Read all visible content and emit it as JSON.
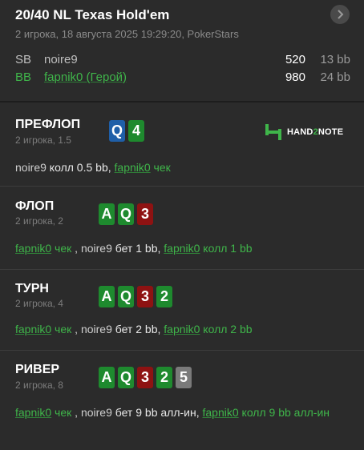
{
  "header": {
    "title": "20/40 NL Texas Hold'em",
    "subtitle": "2 игрока, 18 августа 2025 19:29:20, PokerStars"
  },
  "players": [
    {
      "pos": "SB",
      "name": "noire9",
      "stack": "520",
      "bb": "13 bb"
    },
    {
      "pos": "BB",
      "name": "fapnik0 (Герой)",
      "stack": "980",
      "bb": "24 bb"
    }
  ],
  "logo": {
    "text_a": "HAND",
    "text_b": "2",
    "text_c": "NOTE"
  },
  "colors": {
    "green": "#3fb54a",
    "card_green": "#1e8a2e",
    "card_red": "#8e1212",
    "card_blue": "#1f5fa8",
    "card_gray": "#7a7a7a"
  },
  "streets": [
    {
      "name": "ПРЕФЛОП",
      "sub": "2 игрока, 1.5",
      "cards": [
        {
          "rank": "Q",
          "suit": "blue"
        },
        {
          "rank": "4",
          "suit": "green"
        }
      ],
      "actions": [
        {
          "who": "noire9",
          "hero": false,
          "act": " колл 0.5 bb, "
        },
        {
          "who": "fapnik0",
          "hero": true,
          "act": " чек"
        }
      ]
    },
    {
      "name": "ФЛОП",
      "sub": "2 игрока, 2",
      "cards": [
        {
          "rank": "A",
          "suit": "green"
        },
        {
          "rank": "Q",
          "suit": "green"
        },
        {
          "rank": "3",
          "suit": "red"
        }
      ],
      "actions": [
        {
          "who": "fapnik0",
          "hero": true,
          "act": " чек"
        },
        {
          "who": "noire9",
          "hero": false,
          "act": " бет 1 bb, ",
          "pre": " , "
        },
        {
          "who": "fapnik0",
          "hero": true,
          "act": " колл 1 bb"
        }
      ]
    },
    {
      "name": "ТУРН",
      "sub": "2 игрока, 4",
      "cards": [
        {
          "rank": "A",
          "suit": "green"
        },
        {
          "rank": "Q",
          "suit": "green"
        },
        {
          "rank": "3",
          "suit": "red"
        },
        {
          "rank": "2",
          "suit": "green"
        }
      ],
      "actions": [
        {
          "who": "fapnik0",
          "hero": true,
          "act": " чек"
        },
        {
          "who": "noire9",
          "hero": false,
          "act": " бет 2 bb, ",
          "pre": " , "
        },
        {
          "who": "fapnik0",
          "hero": true,
          "act": " колл 2 bb"
        }
      ]
    },
    {
      "name": "РИВЕР",
      "sub": "2 игрока, 8",
      "cards": [
        {
          "rank": "A",
          "suit": "green"
        },
        {
          "rank": "Q",
          "suit": "green"
        },
        {
          "rank": "3",
          "suit": "red"
        },
        {
          "rank": "2",
          "suit": "green"
        },
        {
          "rank": "5",
          "suit": "gray"
        }
      ],
      "actions": [
        {
          "who": "fapnik0",
          "hero": true,
          "act": " чек"
        },
        {
          "who": "noire9",
          "hero": false,
          "act": " бет 9 bb алл-ин, ",
          "pre": " , "
        },
        {
          "who": "fapnik0",
          "hero": true,
          "act": " колл 9 bb алл-ин"
        }
      ]
    }
  ]
}
